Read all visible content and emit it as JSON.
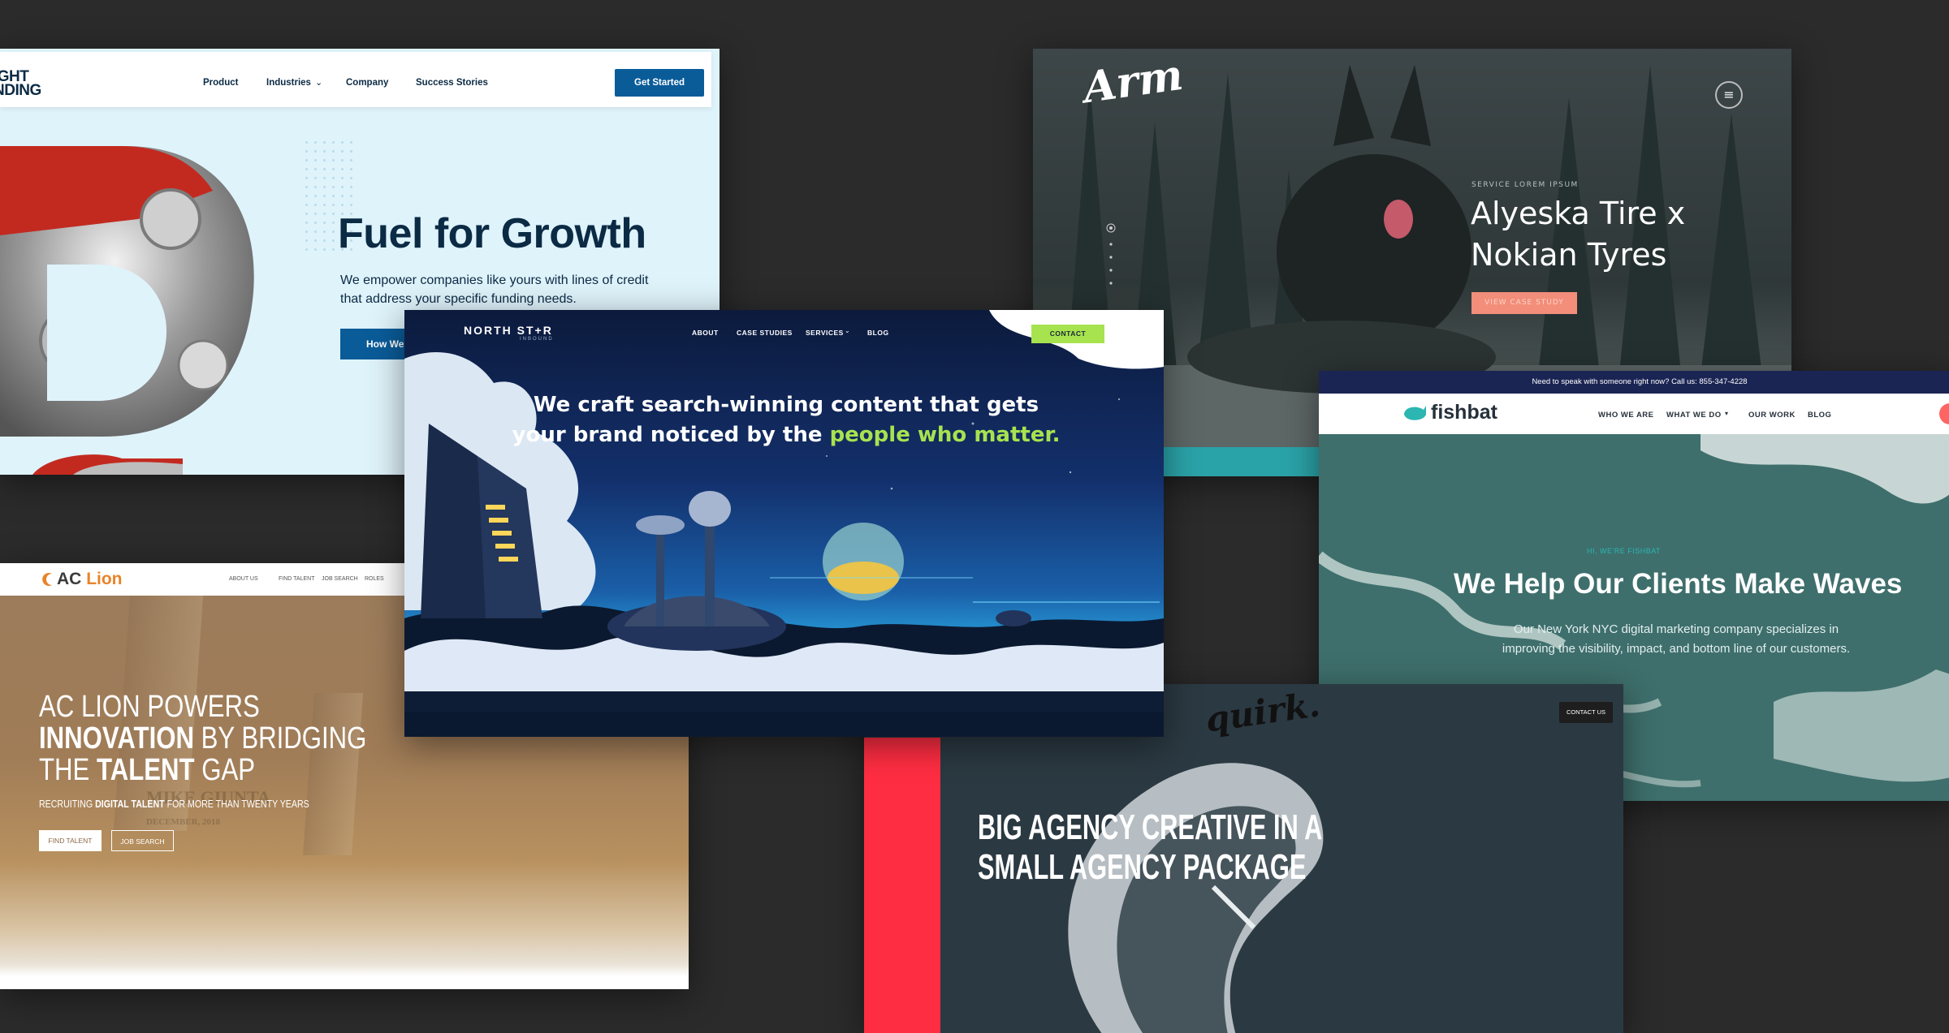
{
  "lightfunding": {
    "logo_line1": "IGHT",
    "logo_line2": "NDING",
    "nav": [
      "Product",
      "Industries",
      "Company",
      "Success Stories"
    ],
    "cta": "Get Started",
    "hero_title": "Fuel for Growth",
    "hero_sub": "We empower companies like yours with lines of credit that address your specific funding needs.",
    "hero_btn": "How We",
    "colors": {
      "bg": "#dff3fb",
      "navy": "#0b2a44",
      "accent": "#0a5c99"
    }
  },
  "arm": {
    "logo": "Arm",
    "eyebrow": "SERVICE LOREM IPSUM",
    "title": "Alyeska Tire x Nokian Tyres",
    "button": "VIEW CASE STUDY",
    "icons": [
      "hamburger-menu-icon"
    ],
    "colors": {
      "button": "#f28e7a",
      "teal": "#2aa3a8"
    }
  },
  "fishbat": {
    "topbar": "Need to speak with someone right now? Call us: 855-347-4228",
    "logo": "fishbat",
    "nav": [
      "WHO WE ARE",
      "WHAT WE DO",
      "OUR WORK",
      "BLOG"
    ],
    "eyebrow": "HI, WE'RE FISHBAT",
    "title": "We Help Our Clients Make Waves",
    "sub": "Our New York NYC digital marketing company specializes in improving the visibility, impact, and bottom line of our customers.",
    "colors": {
      "topbar": "#1b2554",
      "brand": "#2bb6b2"
    }
  },
  "aclion": {
    "logo_a": "AC",
    "logo_b": "Lion",
    "nav": [
      "ABOUT US",
      "FIND TALENT",
      "JOB SEARCH",
      "ROLES"
    ],
    "h1_line1": "AC LION POWERS",
    "h1_line2_bold": "INNOVATION",
    "h1_line2_rest": " BY BRIDGING",
    "h1_line3_a": "THE ",
    "h1_line3_bold": "TALENT",
    "h1_line3_b": " GAP",
    "tag_a": "RECRUITING ",
    "tag_bold": "DIGITAL TALENT",
    "tag_b": " FOR MORE THAN TWENTY YEARS",
    "btn1": "FIND TALENT",
    "btn2": "JOB SEARCH",
    "ghost1": "MIKE GIUNTA",
    "ghost2": "DECEMBER, 2018",
    "colors": {
      "orange": "#e8842a"
    }
  },
  "quirk": {
    "logo": "quirk.",
    "contact": "CONTACT US",
    "title_line1": "BIG AGENCY CREATIVE IN A",
    "title_line2": "SMALL AGENCY PACKAGE",
    "colors": {
      "red": "#ff2d42"
    }
  },
  "northstar": {
    "logo": "NORTH ST+R",
    "logo_sub": "INBOUND",
    "nav": [
      "ABOUT",
      "CASE STUDIES",
      "SERVICES",
      "BLOG"
    ],
    "contact": "CONTACT",
    "title_a": "We craft search-winning content that gets your brand noticed by the ",
    "title_hl": "people who matter.",
    "colors": {
      "accent": "#a7e34f"
    }
  }
}
